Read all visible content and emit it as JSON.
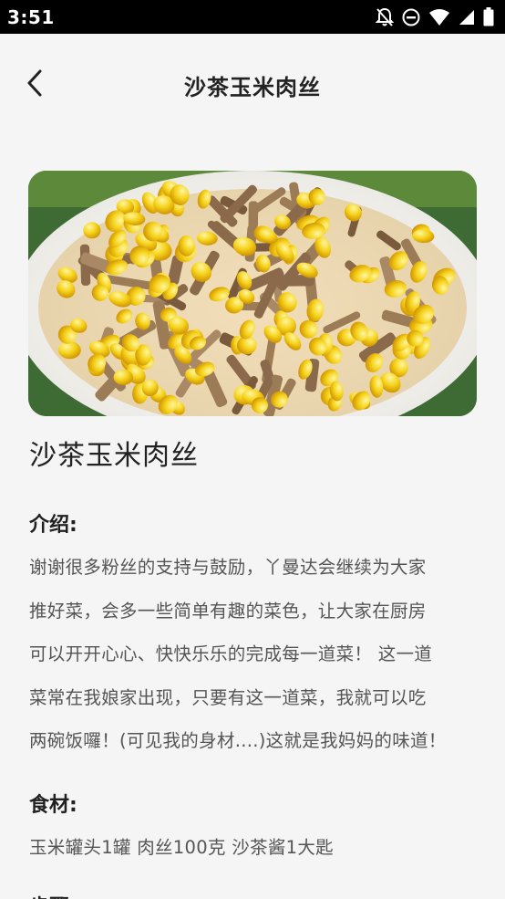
{
  "status_bar": {
    "time": "3:51",
    "icons": [
      "notifications-off-icon",
      "do-not-disturb-icon",
      "wifi-icon",
      "cell-signal-icon",
      "battery-icon"
    ]
  },
  "header": {
    "title": "沙茶玉米肉丝",
    "back_icon": "chevron-left-icon"
  },
  "recipe": {
    "name": "沙茶玉米肉丝",
    "intro_label": "介绍:",
    "intro_lines": [
      "谢谢很多粉丝的支持与鼓励，丫曼达会继续为大家",
      "推好菜，会多一些简单有趣的菜色，让大家在厨房",
      "可以开开心心、快快乐乐的完成每一道菜！ 这一道",
      "菜常在我娘家出现，只要有这一道菜，我就可以吃",
      "两碗饭囉！(可见我的身材....)这就是我妈妈的味道！"
    ],
    "ingredients_label": "食材:",
    "ingredients": "玉米罐头1罐 肉丝100克 沙茶酱1大匙",
    "steps_label": "步骤:"
  },
  "colors": {
    "status_bar_bg": "#000000",
    "page_bg": "#f5f5f5",
    "title_text": "#222222",
    "body_text": "#555555"
  }
}
